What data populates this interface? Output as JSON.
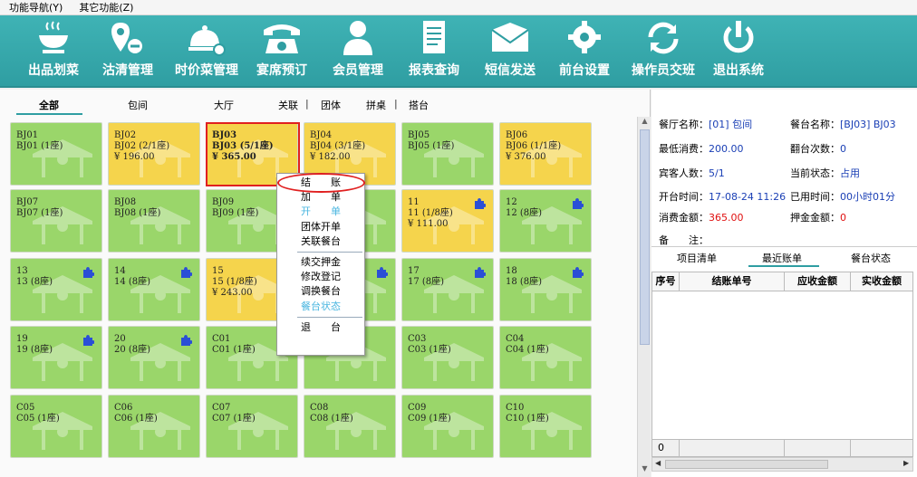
{
  "menu": {
    "nav": "功能导航",
    "nav_key": "(Y)",
    "other": "其它功能",
    "other_key": "(Z)"
  },
  "toolbar": [
    {
      "label": "出品划菜",
      "icon": "bowl-icon"
    },
    {
      "label": "沽清管理",
      "icon": "tag-icon"
    },
    {
      "label": "时价菜管理",
      "icon": "cloche-icon"
    },
    {
      "label": "宴席预订",
      "icon": "phone-icon"
    },
    {
      "label": "会员管理",
      "icon": "person-icon"
    },
    {
      "label": "报表查询",
      "icon": "document-icon"
    },
    {
      "label": "短信发送",
      "icon": "envelope-icon"
    },
    {
      "label": "前台设置",
      "icon": "gear-icon"
    },
    {
      "label": "操作员交班",
      "icon": "refresh-icon"
    },
    {
      "label": "退出系统",
      "icon": "power-icon"
    }
  ],
  "tabs": {
    "all": "全部",
    "room": "包间",
    "hall": "大厅",
    "link": "关联",
    "group": "团体",
    "merge": "拼桌",
    "takeout": "搭台",
    "sep": "|"
  },
  "tiles": [
    {
      "l1": "BJ01",
      "l2": "BJ01 (1座)",
      "l3": "",
      "state": "green",
      "puzzle": false
    },
    {
      "l1": "BJ02",
      "l2": "BJ02 (2/1座)",
      "l3": "¥ 196.00",
      "state": "yellow",
      "puzzle": false
    },
    {
      "l1": "BJ03",
      "l2": "BJ03 (5/1座)",
      "l3": "¥ 365.00",
      "state": "yellow",
      "puzzle": false,
      "selected": true
    },
    {
      "l1": "BJ04",
      "l2": "BJ04 (3/1座)",
      "l3": "¥ 182.00",
      "state": "yellow",
      "puzzle": false
    },
    {
      "l1": "BJ05",
      "l2": "BJ05 (1座)",
      "l3": "",
      "state": "green",
      "puzzle": false
    },
    {
      "l1": "BJ06",
      "l2": "BJ06 (1/1座)",
      "l3": "¥ 376.00",
      "state": "yellow",
      "puzzle": false
    },
    {
      "l1": "BJ07",
      "l2": "BJ07 (1座)",
      "l3": "",
      "state": "green",
      "puzzle": false
    },
    {
      "l1": "BJ08",
      "l2": "BJ08 (1座)",
      "l3": "",
      "state": "green",
      "puzzle": false
    },
    {
      "l1": "BJ09",
      "l2": "BJ09 (1座)",
      "l3": "",
      "state": "green",
      "puzzle": false
    },
    {
      "l1": "",
      "l2": "",
      "l3": "",
      "state": "green",
      "puzzle": false
    },
    {
      "l1": "11",
      "l2": "11 (1/8座)",
      "l3": "¥ 111.00",
      "state": "yellow",
      "puzzle": true
    },
    {
      "l1": "12",
      "l2": "12 (8座)",
      "l3": "",
      "state": "green",
      "puzzle": true
    },
    {
      "l1": "13",
      "l2": "13 (8座)",
      "l3": "",
      "state": "green",
      "puzzle": true
    },
    {
      "l1": "14",
      "l2": "14 (8座)",
      "l3": "",
      "state": "green",
      "puzzle": true
    },
    {
      "l1": "15",
      "l2": "15 (1/8座)",
      "l3": "¥ 243.00",
      "state": "yellow",
      "puzzle": false
    },
    {
      "l1": "",
      "l2": "",
      "l3": "",
      "state": "green",
      "puzzle": true
    },
    {
      "l1": "17",
      "l2": "17 (8座)",
      "l3": "",
      "state": "green",
      "puzzle": true
    },
    {
      "l1": "18",
      "l2": "18 (8座)",
      "l3": "",
      "state": "green",
      "puzzle": true
    },
    {
      "l1": "19",
      "l2": "19 (8座)",
      "l3": "",
      "state": "green",
      "puzzle": true
    },
    {
      "l1": "20",
      "l2": "20 (8座)",
      "l3": "",
      "state": "green",
      "puzzle": true
    },
    {
      "l1": "C01",
      "l2": "C01 (1座)",
      "l3": "",
      "state": "green",
      "puzzle": false
    },
    {
      "l1": "",
      "l2": "",
      "l3": "",
      "state": "green",
      "puzzle": false
    },
    {
      "l1": "C03",
      "l2": "C03 (1座)",
      "l3": "",
      "state": "green",
      "puzzle": false
    },
    {
      "l1": "C04",
      "l2": "C04 (1座)",
      "l3": "",
      "state": "green",
      "puzzle": false
    },
    {
      "l1": "C05",
      "l2": "C05 (1座)",
      "l3": "",
      "state": "green",
      "puzzle": false
    },
    {
      "l1": "C06",
      "l2": "C06 (1座)",
      "l3": "",
      "state": "green",
      "puzzle": false
    },
    {
      "l1": "C07",
      "l2": "C07 (1座)",
      "l3": "",
      "state": "green",
      "puzzle": false
    },
    {
      "l1": "C08",
      "l2": "C08 (1座)",
      "l3": "",
      "state": "green",
      "puzzle": false
    },
    {
      "l1": "C09",
      "l2": "C09 (1座)",
      "l3": "",
      "state": "green",
      "puzzle": false
    },
    {
      "l1": "C10",
      "l2": "C10 (1座)",
      "l3": "",
      "state": "green",
      "puzzle": false
    }
  ],
  "context_menu": [
    {
      "label": "结　　账",
      "disabled": false
    },
    {
      "label": "加　　单",
      "disabled": false
    },
    {
      "label": "开　　单",
      "disabled": true
    },
    {
      "label": "团体开单",
      "disabled": false
    },
    {
      "label": "关联餐台",
      "disabled": false
    },
    {
      "sep": true
    },
    {
      "label": "续交押金",
      "disabled": false
    },
    {
      "label": "修改登记",
      "disabled": false
    },
    {
      "label": "调换餐台",
      "disabled": false
    },
    {
      "label": "餐台状态",
      "disabled": true
    },
    {
      "sep": true
    },
    {
      "label": "退　　台",
      "disabled": false
    }
  ],
  "info": {
    "hall_label": "餐厅名称：",
    "hall_value": "[01] 包间",
    "table_label": "餐台名称：",
    "table_value": "[BJ03] BJ03",
    "min_label": "最低消费：",
    "min_value": "200.00",
    "turn_label": "翻台次数：",
    "turn_value": "0",
    "guest_label": "宾客人数：",
    "guest_value": "5/1",
    "status_label": "当前状态：",
    "status_value": "占用",
    "open_label": "开台时间：",
    "open_value": "17-08-24 11:26",
    "used_label": "已用时间：",
    "used_value": "00小时01分",
    "spend_label": "消费金额：",
    "spend_value": "365.00",
    "deposit_label": "押金金额：",
    "deposit_value": "0",
    "note_label": "备　　注："
  },
  "rtabs": {
    "items": "项目清单",
    "recent": "最近账单",
    "status": "餐台状态"
  },
  "table": {
    "headers": [
      "序号",
      "结账单号",
      "应收金额",
      "实收金额"
    ],
    "footer_count": "0"
  },
  "colors": {
    "toolbar": "#2f9ea2",
    "occupied": "#f5d44c",
    "free": "#9ad66a",
    "highlight": "#e02020"
  }
}
